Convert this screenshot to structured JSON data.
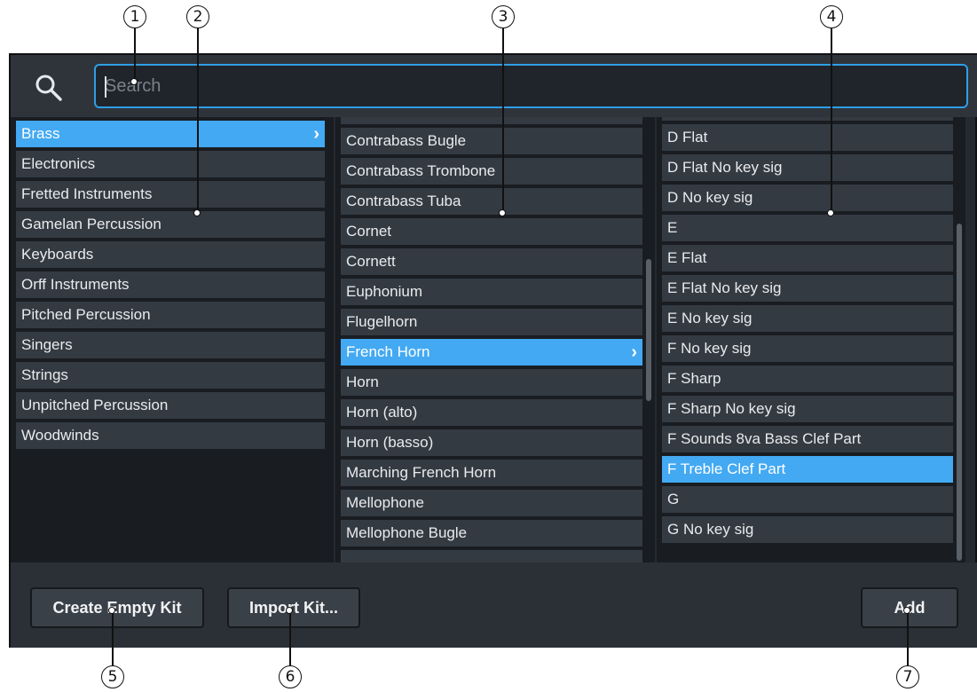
{
  "search": {
    "placeholder": "Search"
  },
  "categories": [
    {
      "label": "Brass",
      "selected": true
    },
    {
      "label": "Electronics"
    },
    {
      "label": "Fretted Instruments"
    },
    {
      "label": "Gamelan Percussion"
    },
    {
      "label": "Keyboards"
    },
    {
      "label": "Orff Instruments"
    },
    {
      "label": "Pitched Percussion"
    },
    {
      "label": "Singers"
    },
    {
      "label": "Strings"
    },
    {
      "label": "Unpitched Percussion"
    },
    {
      "label": "Woodwinds"
    }
  ],
  "instruments": [
    {
      "label": "Contrabass Bugle"
    },
    {
      "label": "Contrabass Trombone"
    },
    {
      "label": "Contrabass Tuba"
    },
    {
      "label": "Cornet"
    },
    {
      "label": "Cornett"
    },
    {
      "label": "Euphonium"
    },
    {
      "label": "Flugelhorn"
    },
    {
      "label": "French Horn",
      "selected": true
    },
    {
      "label": "Horn"
    },
    {
      "label": "Horn (alto)"
    },
    {
      "label": "Horn (basso)"
    },
    {
      "label": "Marching French Horn"
    },
    {
      "label": "Mellophone"
    },
    {
      "label": "Mellophone Bugle"
    }
  ],
  "variants": [
    {
      "label": "D Flat"
    },
    {
      "label": "D Flat No key sig"
    },
    {
      "label": "D No key sig"
    },
    {
      "label": "E"
    },
    {
      "label": "E Flat"
    },
    {
      "label": "E Flat No key sig"
    },
    {
      "label": "E No key sig"
    },
    {
      "label": "F No key sig"
    },
    {
      "label": "F Sharp"
    },
    {
      "label": "F Sharp No key sig"
    },
    {
      "label": "F Sounds 8va Bass Clef Part"
    },
    {
      "label": "F Treble Clef Part",
      "selected": true
    },
    {
      "label": "G"
    },
    {
      "label": "G No key sig"
    }
  ],
  "buttons": {
    "create_empty_kit": "Create Empty Kit",
    "import_kit": "Import Kit...",
    "add": "Add"
  },
  "callouts": [
    "1",
    "2",
    "3",
    "4",
    "5",
    "6",
    "7"
  ],
  "colors": {
    "accent": "#43a9f2",
    "item_bg": "#343a42",
    "panel_bg": "#191d22"
  }
}
